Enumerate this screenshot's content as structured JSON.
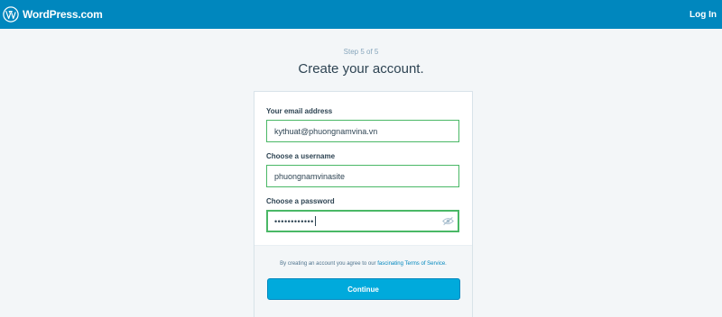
{
  "header": {
    "brand": "WordPress.com",
    "login_link": "Log In",
    "background_color": "#0087be"
  },
  "progress": {
    "step_text": "Step 5 of 5"
  },
  "page": {
    "title": "Create your account."
  },
  "form": {
    "email": {
      "label": "Your email address",
      "value": "kythuat@phuongnamvina.vn"
    },
    "username": {
      "label": "Choose a username",
      "value": "phuongnamvinasite"
    },
    "password": {
      "label": "Choose a password",
      "masked_value": "••••••••••••",
      "icon": "eye-hidden-icon"
    }
  },
  "terms": {
    "prefix": "By creating an account you agree to our ",
    "link": "fascinating Terms of Service",
    "suffix": "."
  },
  "submit": {
    "label": "Continue",
    "color": "#00aadc"
  },
  "field_valid_color": "#4ab866"
}
